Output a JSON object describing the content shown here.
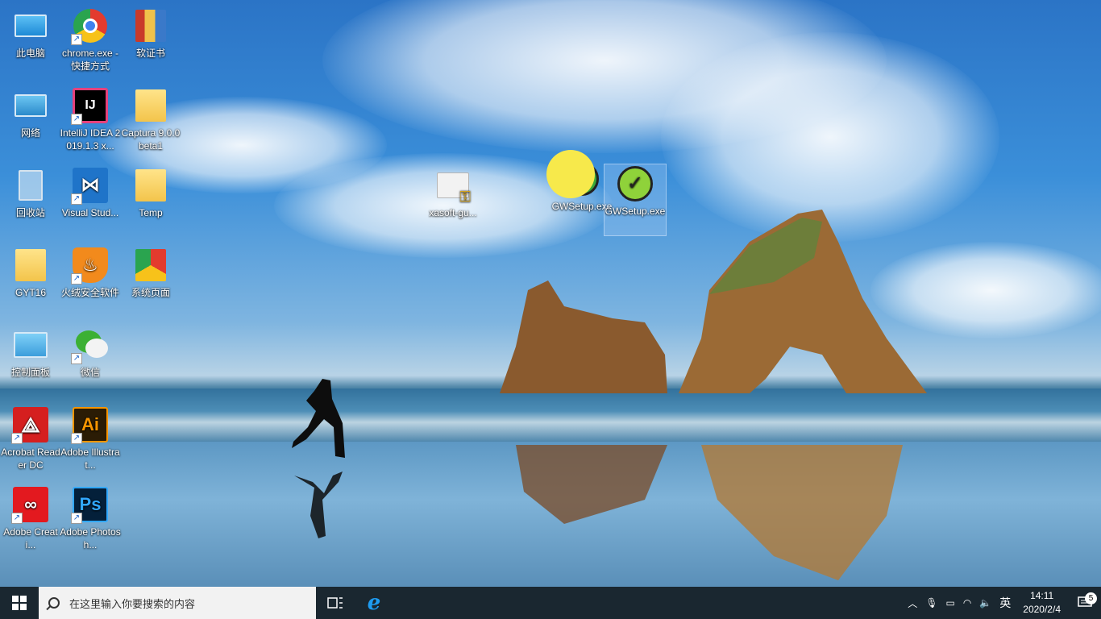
{
  "desktop": {
    "icons": [
      {
        "label": "此电脑",
        "icon": "computer-icon"
      },
      {
        "label": "chrome.exe - 快捷方式",
        "icon": "chrome-icon"
      },
      {
        "label": "软证书",
        "icon": "archive-icon"
      },
      {
        "label": "网络",
        "icon": "network-icon"
      },
      {
        "label": "IntelliJ IDEA 2019.1.3 x...",
        "icon": "intellij-icon"
      },
      {
        "label": "Captura 9.0.0 beta1",
        "icon": "folder-icon"
      },
      {
        "label": "回收站",
        "icon": "recycle-bin-icon"
      },
      {
        "label": "Visual Stud...",
        "icon": "visual-studio-icon"
      },
      {
        "label": "Temp",
        "icon": "folder-icon"
      },
      {
        "label": "GYT16",
        "icon": "user-folder-icon"
      },
      {
        "label": "火绒安全软件",
        "icon": "huorong-icon"
      },
      {
        "label": "系统页面",
        "icon": "chrome-folder-icon"
      },
      {
        "label": "控制面板",
        "icon": "control-panel-icon"
      },
      {
        "label": "微信",
        "icon": "wechat-icon"
      },
      {
        "label": "Acrobat Reader DC",
        "icon": "acrobat-icon"
      },
      {
        "label": "Adobe Illustrat...",
        "icon": "illustrator-icon"
      },
      {
        "label": "Adobe Creati...",
        "icon": "creative-cloud-icon"
      },
      {
        "label": "Adobe Photosh...",
        "icon": "photoshop-icon"
      },
      {
        "label": "xasoft-gu...",
        "icon": "certificate-icon"
      },
      {
        "label": "GWSetup.exe",
        "icon": "gwsetup-icon"
      },
      {
        "label": "GWSetup.exe",
        "icon": "gwsetup-icon"
      }
    ]
  },
  "taskbar": {
    "search_placeholder": "在这里输入你要搜索的内容",
    "ime": "英",
    "time": "14:11",
    "date": "2020/2/4",
    "notification_count": "5",
    "colors": {
      "taskbar": "#1a2730",
      "search_bg": "#f2f2f2"
    }
  }
}
